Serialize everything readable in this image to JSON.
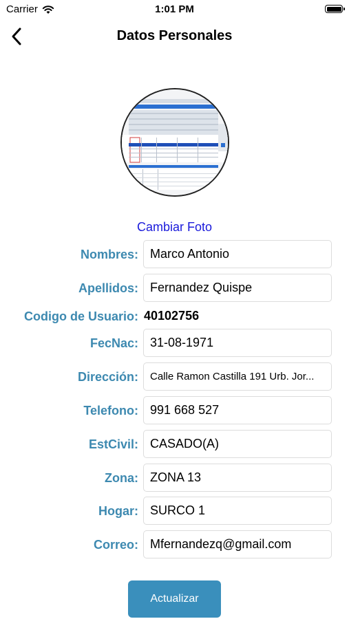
{
  "status_bar": {
    "carrier": "Carrier",
    "time": "1:01 PM"
  },
  "nav": {
    "title": "Datos Personales",
    "back_icon": "chevron-left-icon"
  },
  "photo": {
    "change_label": "Cambiar Foto"
  },
  "form": {
    "nombres": {
      "label": "Nombres:",
      "value": "Marco Antonio"
    },
    "apellidos": {
      "label": "Apellidos:",
      "value": "Fernandez Quispe"
    },
    "codigo": {
      "label": "Codigo de Usuario:",
      "value": "40102756"
    },
    "fecnac": {
      "label": "FecNac:",
      "value": "31-08-1971"
    },
    "direccion": {
      "label": "Dirección:",
      "value": "Calle Ramon Castilla 191 Urb. Jor..."
    },
    "telefono": {
      "label": "Telefono:",
      "value": "991 668 527"
    },
    "estcivil": {
      "label": "EstCivil:",
      "value": "CASADO(A)"
    },
    "zona": {
      "label": "Zona:",
      "value": "ZONA 13"
    },
    "hogar": {
      "label": "Hogar:",
      "value": "SURCO 1"
    },
    "correo": {
      "label": "Correo:",
      "value": "Mfernandezq@gmail.com"
    }
  },
  "actions": {
    "update_label": "Actualizar"
  },
  "colors": {
    "label": "#3d89b0",
    "link": "#1a1adb",
    "button": "#3a8fbc"
  }
}
